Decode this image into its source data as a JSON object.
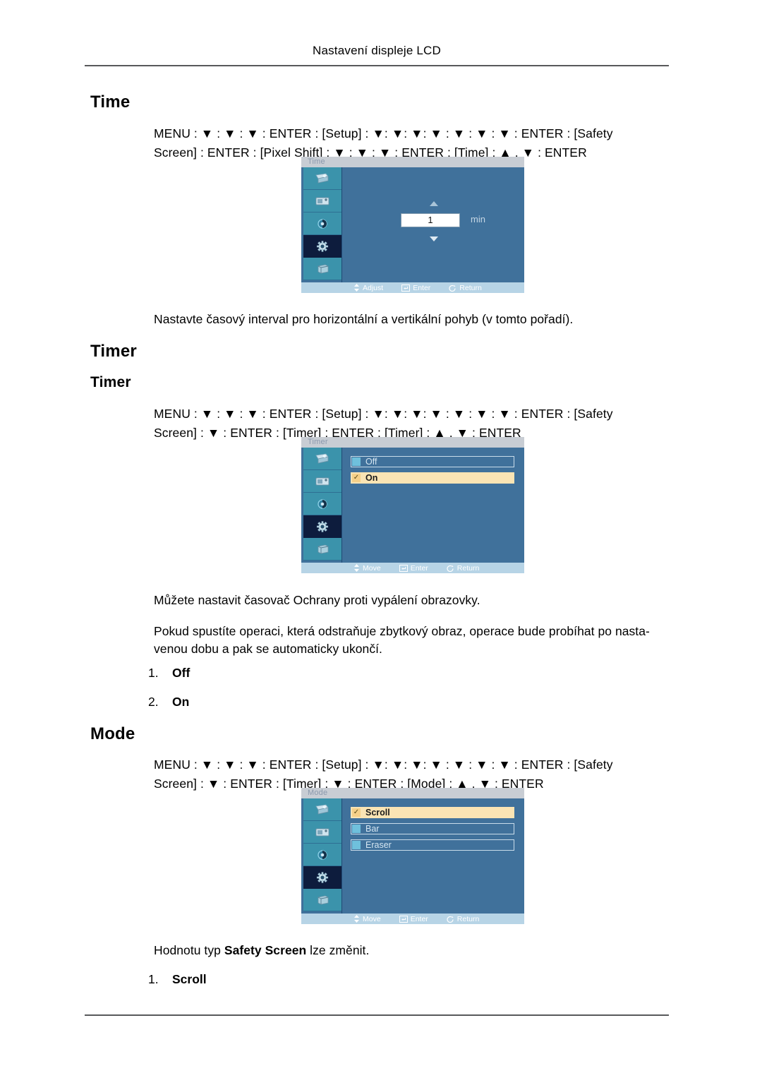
{
  "header": {
    "running_head": "Nastavení displeje LCD"
  },
  "sections": [
    {
      "id": "time",
      "heading": "Time",
      "path_line1": "MENU : ▼ : ▼ : ▼ : ENTER : [Setup] : ▼: ▼: ▼: ▼ : ▼ : ▼ : ▼ : ENTER : [Safety",
      "path_line2": "Screen] : ENTER : [Pixel Shift] :     ▼ : ▼ : ▼ : ENTER : [Time] :    ▲ , ▼ : ENTER",
      "caption": "Nastavte časový interval pro horizontální a vertikální pohyb (v tomto pořadí)."
    },
    {
      "id": "timer",
      "heading": "Timer",
      "subheading": "Timer",
      "path_line1": "MENU : ▼ : ▼ : ▼ : ENTER : [Setup] : ▼: ▼: ▼: ▼ : ▼ : ▼ : ▼ : ENTER : [Safety",
      "path_line2": "Screen] : ▼ : ENTER : [Timer] : ENTER : [Timer] :      ▲ , ▼ : ENTER",
      "caption1": "Můžete nastavit časovač Ochrany proti vypálení obrazovky.",
      "caption2": "Pokud spustíte operaci, která odstraňuje zbytkový obraz, operace bude probíhat po nasta-venou dobu a pak se automaticky ukončí.",
      "items": [
        {
          "num": "1.",
          "value": "Off"
        },
        {
          "num": "2.",
          "value": "On"
        }
      ]
    },
    {
      "id": "mode",
      "heading": "Mode",
      "path_line1": "MENU : ▼ : ▼ : ▼ : ENTER : [Setup] : ▼: ▼: ▼: ▼ : ▼ : ▼ : ▼ : ENTER : [Safety",
      "path_line2": "Screen] : ▼ : ENTER : [Timer] :    ▼ : ENTER : [Mode] :   ▲ , ▼ : ENTER",
      "caption_pre": "Hodnotu typ ",
      "caption_bold": "Safety Screen",
      "caption_post": " lze změnit.",
      "items": [
        {
          "num": "1.",
          "value": "Scroll"
        }
      ]
    }
  ],
  "osd_time": {
    "title": "Time",
    "spinner": {
      "value": "1",
      "unit": "min"
    },
    "footer": [
      {
        "icon": "updown-arrow-icon",
        "label": "Adjust"
      },
      {
        "icon": "enter-key-icon",
        "label": "Enter"
      },
      {
        "icon": "return-arrow-icon",
        "label": "Return"
      }
    ]
  },
  "osd_timer": {
    "title": "Timer",
    "options": [
      {
        "label": "Off",
        "selected": false
      },
      {
        "label": "On",
        "selected": true
      }
    ],
    "footer": [
      {
        "icon": "updown-arrow-icon",
        "label": "Move"
      },
      {
        "icon": "enter-key-icon",
        "label": "Enter"
      },
      {
        "icon": "return-arrow-icon",
        "label": "Return"
      }
    ]
  },
  "osd_mode": {
    "title": "Mode",
    "options": [
      {
        "label": "Scroll",
        "selected": true
      },
      {
        "label": "Bar",
        "selected": false
      },
      {
        "label": "Eraser",
        "selected": false
      }
    ],
    "footer": [
      {
        "icon": "updown-arrow-icon",
        "label": "Move"
      },
      {
        "icon": "enter-key-icon",
        "label": "Enter"
      },
      {
        "icon": "return-arrow-icon",
        "label": "Return"
      }
    ]
  },
  "osd_sidebar": {
    "items": [
      {
        "icon": "picture-icon",
        "selected": false
      },
      {
        "icon": "screen-adjust-icon",
        "selected": false
      },
      {
        "icon": "sound-icon",
        "selected": false
      },
      {
        "icon": "setup-gear-icon",
        "selected": true
      },
      {
        "icon": "multi-control-icon",
        "selected": false
      }
    ]
  },
  "colors": {
    "osd_body": "#40719b",
    "osd_sidebar": "#3b93ab",
    "osd_selected": "#0d1c3d",
    "osd_title_bar": "#c8cdd4",
    "osd_footer": "#b7d4e6",
    "option_selected": "#fae4b4",
    "rule": "#58595b"
  }
}
